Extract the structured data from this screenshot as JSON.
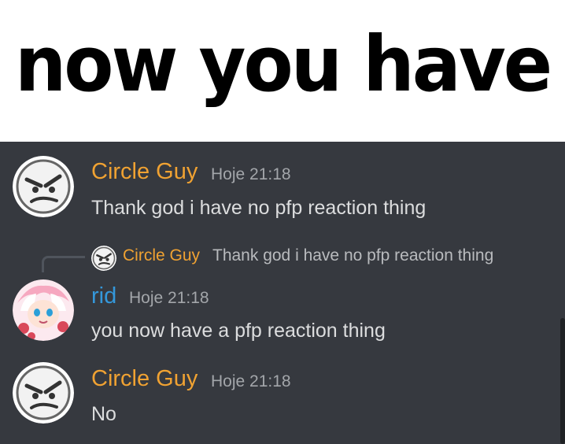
{
  "caption": "now you have",
  "colors": {
    "chat_background": "#36393f",
    "circle_guy_name": "#f0a232",
    "rid_name": "#3498db",
    "message_text": "#dcddde",
    "timestamp_text": "#a3a6aa"
  },
  "messages": [
    {
      "author": "Circle Guy",
      "timestamp": "Hoje 21:18",
      "text": "Thank god i have no pfp reaction thing",
      "avatar_icon": "angry-face-avatar"
    },
    {
      "reply_to": {
        "author": "Circle Guy",
        "text": "Thank god i have no pfp reaction thing",
        "avatar_icon": "angry-face-avatar"
      },
      "author": "rid",
      "timestamp": "Hoje 21:18",
      "text": "you now have a pfp reaction thing",
      "avatar_icon": "anime-character-avatar"
    },
    {
      "author": "Circle Guy",
      "timestamp": "Hoje 21:18",
      "text": "No",
      "avatar_icon": "angry-face-avatar"
    }
  ]
}
